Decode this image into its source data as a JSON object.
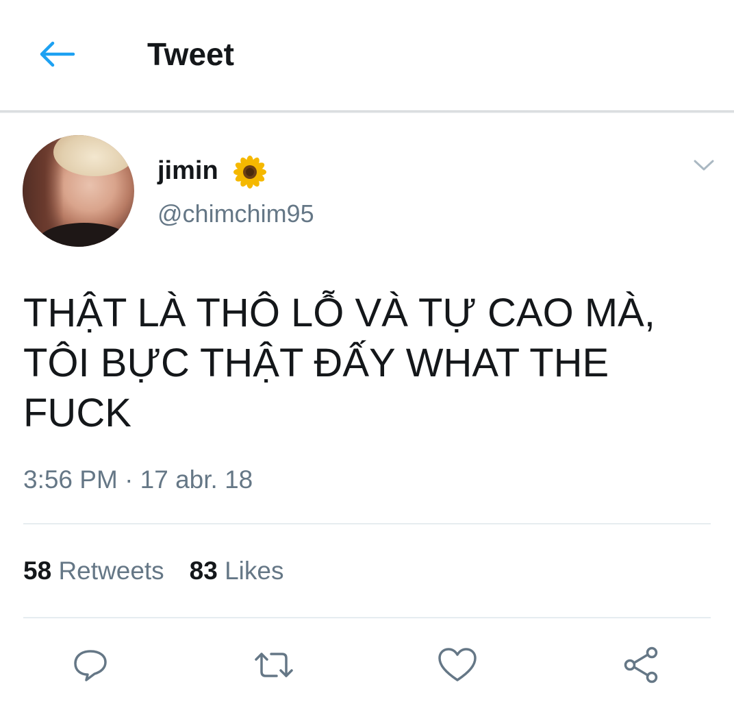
{
  "header": {
    "title": "Tweet",
    "back_icon": "arrow-left-icon",
    "accent": "#1da1f2"
  },
  "tweet": {
    "author": {
      "name": "jimin",
      "emoji_icon": "sunflower-icon",
      "handle": "@chimchim95"
    },
    "menu_icon": "chevron-down-icon",
    "text": "THẬT LÀ THÔ LỖ VÀ TỰ CAO MÀ,\nTÔI BỰC THẬT ĐẤY WHAT THE\nFUCK",
    "timestamp": "3:56 PM · 17 abr. 18",
    "stats": {
      "retweets_count": "58",
      "retweets_label": "Retweets",
      "likes_count": "83",
      "likes_label": "Likes"
    },
    "actions": [
      "reply-icon",
      "retweet-icon",
      "like-icon",
      "share-icon"
    ]
  },
  "colors": {
    "text_primary": "#14171a",
    "text_secondary": "#657786",
    "divider": "#e6ecf0",
    "icon_gray": "#657786"
  }
}
